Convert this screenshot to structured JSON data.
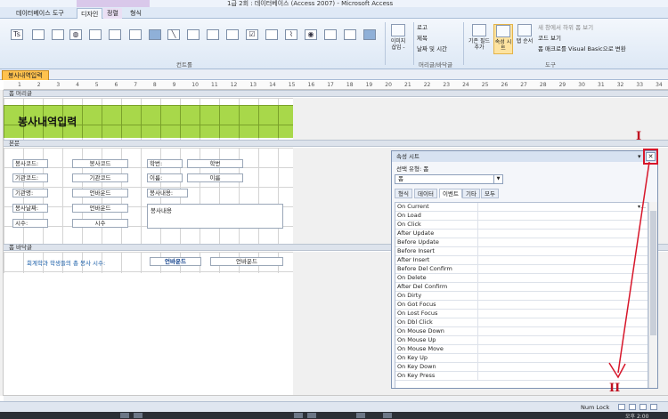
{
  "window": {
    "title": "1급 2회 : 데이터베이스 (Access 2007) - Microsoft Access",
    "context_tab": "양식 디자인 도구"
  },
  "ribbon": {
    "tabs": [
      {
        "label": "데이터베이스 도구",
        "context": false,
        "active": false
      },
      {
        "label": "디자인",
        "context": true,
        "active": true
      },
      {
        "label": "정렬",
        "context": true,
        "active": false
      },
      {
        "label": "형식",
        "context": false,
        "active": false
      }
    ],
    "controls_group_label": "컨트롤",
    "header_footer_group_label": "머리글/바닥글",
    "tools_group_label": "도구",
    "image_insert_label": "이미지 삽입 -",
    "logo_label": "로고",
    "title_label": "제목",
    "datetime_label": "날짜 및 시간",
    "add_existing_fields_label": "기존 필드 추가",
    "property_sheet_label": "속성 시트",
    "tab_order_label": "탭 순서",
    "new_window_label": "새 창에서 하위 폼 보기",
    "view_code_label": "코드 보기",
    "convert_macro_label": "폼 매크로를 Visual Basic으로 변환"
  },
  "document": {
    "tab_label": "봉사내역입력",
    "ruler_numbers": [
      "1",
      "2",
      "3",
      "4",
      "5",
      "6",
      "7",
      "8",
      "9",
      "10",
      "11",
      "12",
      "13",
      "14",
      "15",
      "16",
      "17",
      "18",
      "19",
      "20",
      "21",
      "22",
      "23",
      "24",
      "25",
      "26",
      "27",
      "28",
      "29",
      "30",
      "31",
      "32",
      "33",
      "34"
    ]
  },
  "form": {
    "header_section": "폼 머리글",
    "detail_section": "본문",
    "footer_section": "폼 바닥글",
    "title": "봉사내역입력",
    "fields": [
      {
        "label": "봉사코드:",
        "control": "봉사코드"
      },
      {
        "label": "기관코드:",
        "control": "기관코드"
      },
      {
        "label": "기관명:",
        "control": "언바운드"
      },
      {
        "label": "봉사날짜:",
        "control": "언바운드"
      },
      {
        "label": "시수:",
        "control": "시수"
      }
    ],
    "right_fields": [
      {
        "label": "학번:",
        "control": "학번"
      },
      {
        "label": "이름:",
        "control": "이름"
      },
      {
        "label": "봉사내용:",
        "control": "봉사내용"
      }
    ],
    "footer_label": "회계학과 학생들의 총 봉사 시수:",
    "footer_value": "언바운드",
    "footer_box": "언바운드"
  },
  "property_sheet": {
    "title": "속성 시트",
    "selection_type": "선택 유형: 폼",
    "selected_object": "폼",
    "tabs": [
      "형식",
      "데이터",
      "이벤트",
      "기타",
      "모두"
    ],
    "active_tab": "이벤트",
    "events": [
      "On Current",
      "On Load",
      "On Click",
      "After Update",
      "Before Update",
      "Before Insert",
      "After Insert",
      "Before Del Confirm",
      "On Delete",
      "After Del Confirm",
      "On Dirty",
      "On Got Focus",
      "On Lost Focus",
      "On Dbl Click",
      "On Mouse Down",
      "On Mouse Up",
      "On Mouse Move",
      "On Key Up",
      "On Key Down",
      "On Key Press"
    ],
    "close_icon": "✕"
  },
  "annotations": {
    "marker_1": "I",
    "marker_2": "II",
    "color": "#d7162a"
  },
  "statusbar": {
    "num_lock": "Num Lock"
  },
  "taskbar": {
    "clock": "오후 2:00"
  }
}
